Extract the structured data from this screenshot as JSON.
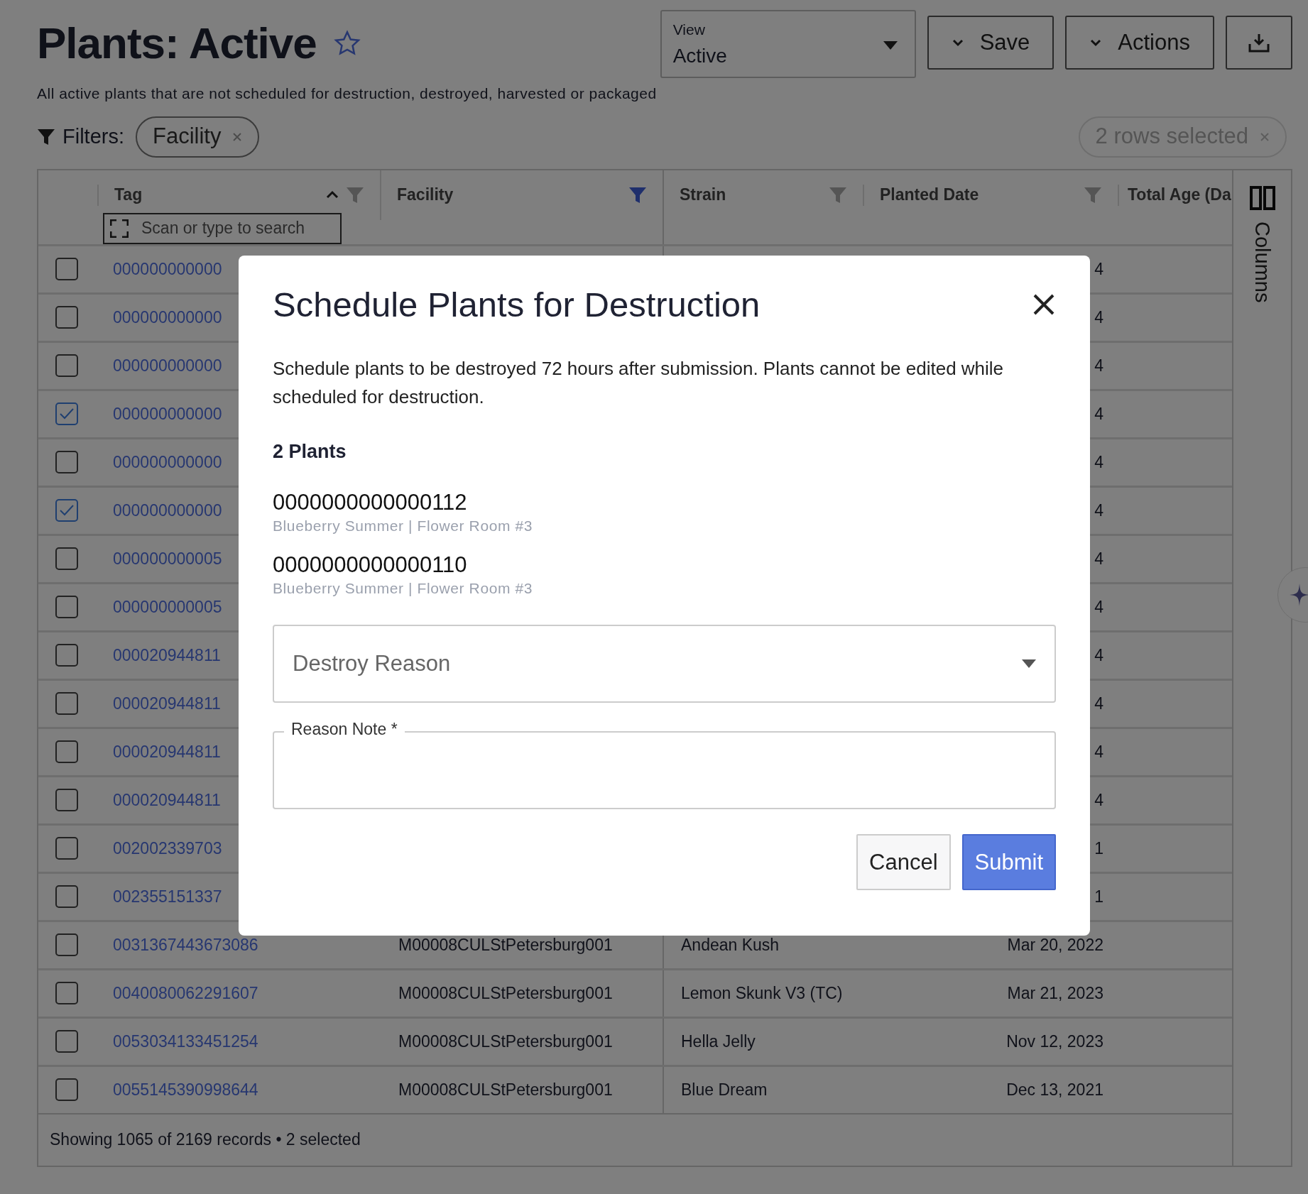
{
  "page": {
    "title": "Plants: Active",
    "favorite": false,
    "subtitle": "All active plants that are not scheduled for destruction, destroyed, harvested or packaged"
  },
  "view_select": {
    "label": "View",
    "value": "Active"
  },
  "toolbar_buttons": [
    {
      "label": "Save"
    },
    {
      "label": "Actions"
    }
  ],
  "filters": {
    "label": "Filters:",
    "chips": [
      {
        "label": "Facility"
      }
    ],
    "selection_chip": {
      "label": "2 rows selected",
      "disabled": true
    }
  },
  "table": {
    "columns": [
      {
        "label": "Tag",
        "sorted": true,
        "filtered": false
      },
      {
        "label": "Facility",
        "sorted": false,
        "filtered": true
      },
      {
        "label": "Strain",
        "sorted": false,
        "filtered": false
      },
      {
        "label": "Planted Date",
        "sorted": false,
        "filtered": false
      },
      {
        "label": "Total Age (Da",
        "sorted": false
      }
    ],
    "search": {
      "placeholder": "Scan or type to search"
    },
    "rows": [
      {
        "checked": false,
        "tag": "000000000000",
        "planted_date": "4"
      },
      {
        "checked": false,
        "tag": "000000000000",
        "planted_date": "4"
      },
      {
        "checked": false,
        "tag": "000000000000",
        "planted_date": "4"
      },
      {
        "checked": true,
        "tag": "000000000000",
        "planted_date": "4"
      },
      {
        "checked": false,
        "tag": "000000000000",
        "planted_date": "4"
      },
      {
        "checked": true,
        "tag": "000000000000",
        "planted_date": "4"
      },
      {
        "checked": false,
        "tag": "000000000005",
        "planted_date": "4"
      },
      {
        "checked": false,
        "tag": "000000000005",
        "planted_date": "4"
      },
      {
        "checked": false,
        "tag": "000020944811",
        "planted_date": "4"
      },
      {
        "checked": false,
        "tag": "000020944811",
        "planted_date": "4"
      },
      {
        "checked": false,
        "tag": "000020944811",
        "planted_date": "4"
      },
      {
        "checked": false,
        "tag": "000020944811",
        "planted_date": "4"
      },
      {
        "checked": false,
        "tag": "002002339703",
        "planted_date": "1"
      },
      {
        "checked": false,
        "tag": "002355151337",
        "planted_date": "1"
      },
      {
        "checked": false,
        "tag": "0031367443673086",
        "facility": "M00008CULStPetersburg001",
        "strain": "Andean Kush",
        "planted_date": "Mar 20, 2022"
      },
      {
        "checked": false,
        "tag": "0040080062291607",
        "facility": "M00008CULStPetersburg001",
        "strain": "Lemon Skunk V3 (TC)",
        "planted_date": "Mar 21, 2023"
      },
      {
        "checked": false,
        "tag": "0053034133451254",
        "facility": "M00008CULStPetersburg001",
        "strain": "Hella Jelly",
        "planted_date": "Nov 12, 2023"
      },
      {
        "checked": false,
        "tag": "0055145390998644",
        "facility": "M00008CULStPetersburg001",
        "strain": "Blue Dream",
        "planted_date": "Dec 13, 2021"
      }
    ],
    "footer": "Showing 1065 of 2169 records • 2 selected",
    "columns_panel": {
      "label": "Columns"
    }
  },
  "modal": {
    "title": "Schedule Plants for Destruction",
    "description": "Schedule plants to be destroyed 72 hours after submission. Plants cannot be edited while scheduled for destruction.",
    "count_label": "2 Plants",
    "plants": [
      {
        "tag": "0000000000000112",
        "detail": "Blueberry Summer | Flower Room #3"
      },
      {
        "tag": "0000000000000110",
        "detail": "Blueberry Summer | Flower Room #3"
      }
    ],
    "reason_select": {
      "placeholder": "Destroy Reason"
    },
    "reason_note": {
      "label": "Reason Note *"
    },
    "buttons": [
      {
        "label": "Cancel",
        "kind": "secondary"
      },
      {
        "label": "Submit",
        "kind": "primary"
      }
    ]
  }
}
